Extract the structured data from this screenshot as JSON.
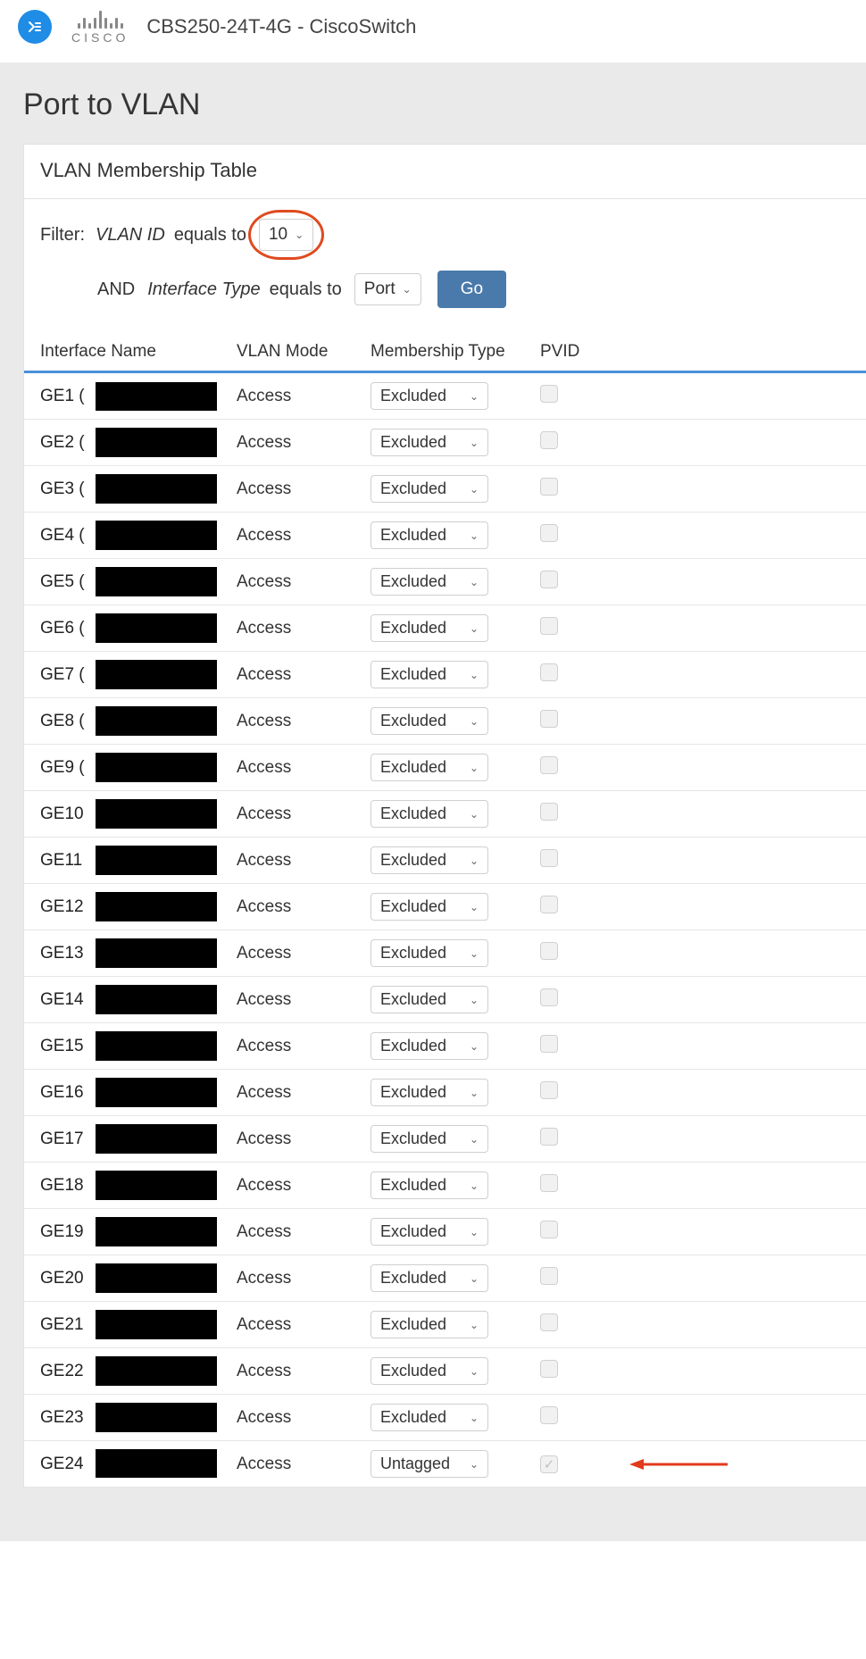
{
  "device_title": "CBS250-24T-4G - CiscoSwitch",
  "page_title": "Port to VLAN",
  "panel_title": "VLAN Membership Table",
  "filter": {
    "label": "Filter:",
    "vlan_id_label": "VLAN ID",
    "equals_to": "equals to",
    "vlan_id_value": "10",
    "and_label": "AND",
    "iftype_label": "Interface Type",
    "iftype_value": "Port",
    "go_label": "Go"
  },
  "columns": {
    "ifname": "Interface Name",
    "mode": "VLAN Mode",
    "membership": "Membership Type",
    "pvid": "PVID"
  },
  "rows": [
    {
      "ifname": "GE1 (",
      "mode": "Access",
      "membership": "Excluded",
      "pvid": false
    },
    {
      "ifname": "GE2 (",
      "mode": "Access",
      "membership": "Excluded",
      "pvid": false
    },
    {
      "ifname": "GE3 (",
      "mode": "Access",
      "membership": "Excluded",
      "pvid": false
    },
    {
      "ifname": "GE4 (",
      "mode": "Access",
      "membership": "Excluded",
      "pvid": false
    },
    {
      "ifname": "GE5 (",
      "mode": "Access",
      "membership": "Excluded",
      "pvid": false
    },
    {
      "ifname": "GE6 (",
      "mode": "Access",
      "membership": "Excluded",
      "pvid": false
    },
    {
      "ifname": "GE7 (",
      "mode": "Access",
      "membership": "Excluded",
      "pvid": false
    },
    {
      "ifname": "GE8 (",
      "mode": "Access",
      "membership": "Excluded",
      "pvid": false
    },
    {
      "ifname": "GE9 (",
      "mode": "Access",
      "membership": "Excluded",
      "pvid": false
    },
    {
      "ifname": "GE10",
      "mode": "Access",
      "membership": "Excluded",
      "pvid": false
    },
    {
      "ifname": "GE11",
      "mode": "Access",
      "membership": "Excluded",
      "pvid": false
    },
    {
      "ifname": "GE12",
      "mode": "Access",
      "membership": "Excluded",
      "pvid": false
    },
    {
      "ifname": "GE13",
      "mode": "Access",
      "membership": "Excluded",
      "pvid": false
    },
    {
      "ifname": "GE14",
      "mode": "Access",
      "membership": "Excluded",
      "pvid": false
    },
    {
      "ifname": "GE15",
      "mode": "Access",
      "membership": "Excluded",
      "pvid": false
    },
    {
      "ifname": "GE16",
      "mode": "Access",
      "membership": "Excluded",
      "pvid": false
    },
    {
      "ifname": "GE17",
      "mode": "Access",
      "membership": "Excluded",
      "pvid": false
    },
    {
      "ifname": "GE18",
      "mode": "Access",
      "membership": "Excluded",
      "pvid": false
    },
    {
      "ifname": "GE19",
      "mode": "Access",
      "membership": "Excluded",
      "pvid": false
    },
    {
      "ifname": "GE20",
      "mode": "Access",
      "membership": "Excluded",
      "pvid": false
    },
    {
      "ifname": "GE21",
      "mode": "Access",
      "membership": "Excluded",
      "pvid": false
    },
    {
      "ifname": "GE22",
      "mode": "Access",
      "membership": "Excluded",
      "pvid": false
    },
    {
      "ifname": "GE23",
      "mode": "Access",
      "membership": "Excluded",
      "pvid": false
    },
    {
      "ifname": "GE24",
      "mode": "Access",
      "membership": "Untagged",
      "pvid": true,
      "arrow": true
    }
  ]
}
